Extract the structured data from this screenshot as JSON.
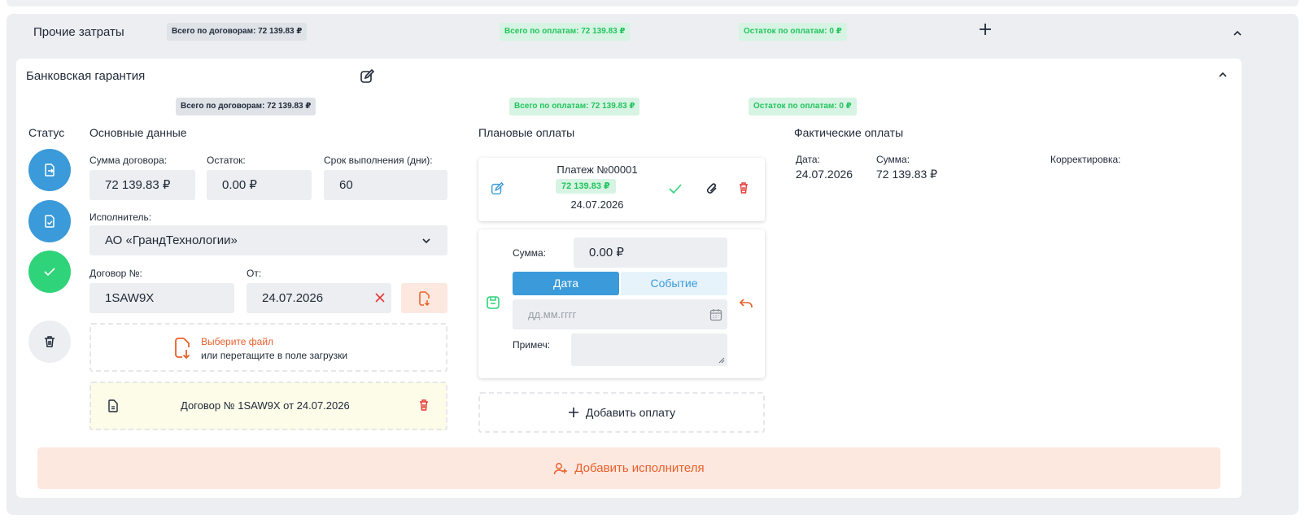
{
  "section": {
    "title": "Прочие затраты",
    "total_contracts": "Всего по договорам: 72 139.83 ₽",
    "total_payments": "Всего по оплатам: 72 139.83 ₽",
    "remaining_payments": "Остаток по оплатам: 0 ₽"
  },
  "card": {
    "title": "Банковская гарантия",
    "total_contracts": "Всего по договорам: 72 139.83 ₽",
    "total_payments": "Всего по оплатам: 72 139.83 ₽",
    "remaining_payments": "Остаток по оплатам: 0 ₽"
  },
  "status": {
    "label": "Статус"
  },
  "main": {
    "label": "Основные данные",
    "contract_sum_label": "Сумма договора:",
    "contract_sum": "72 139.83 ₽",
    "remainder_label": "Остаток:",
    "remainder": "0.00 ₽",
    "term_label": "Срок выполнения (дни):",
    "term": "60",
    "executor_label": "Исполнитель:",
    "executor": "АО «ГрандТехнологии»",
    "contract_no_label": "Договор №:",
    "contract_no": "1SAW9X",
    "from_label": "От:",
    "from_date": "24.07.2026",
    "upload_title": "Выберите файл",
    "upload_sub": "или перетащите в поле загрузки",
    "file_name": "Договор № 1SAW9X от 24.07.2026"
  },
  "planned": {
    "label": "Плановые оплаты",
    "payment_title": "Платеж №00001",
    "payment_amount": "72 139.83 ₽",
    "payment_date": "24.07.2026",
    "sum_label": "Сумма:",
    "sum_value": "0.00 ₽",
    "seg_date": "Дата",
    "seg_event": "Событие",
    "date_placeholder": "дд.мм.гггг",
    "note_label": "Примеч:",
    "add_payment": "Добавить оплату"
  },
  "actual": {
    "label": "Фактические оплаты",
    "date_label": "Дата:",
    "date": "24.07.2026",
    "sum_label": "Сумма:",
    "sum": "72 139.83 ₽",
    "correction_label": "Корректировка:"
  },
  "add_executor": "Добавить исполнителя",
  "colors": {
    "accent_blue": "#3b9ad9",
    "success_green": "#2fd37a",
    "danger_red": "#e53935",
    "orange": "#e8602c"
  }
}
